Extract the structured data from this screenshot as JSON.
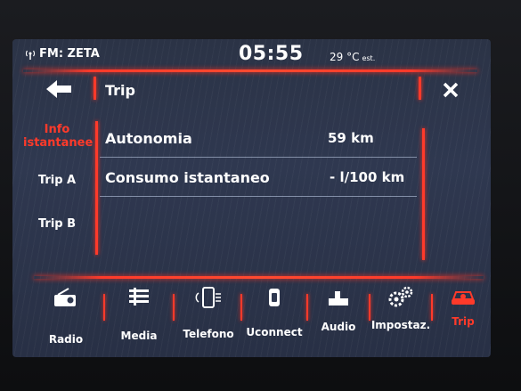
{
  "status": {
    "radio": "FM: ZETA",
    "clock": "05:55",
    "temperature": "29 °C",
    "temperature_note": "est."
  },
  "header": {
    "title": "Trip",
    "back_icon": "back-arrow-icon",
    "close_icon": "close-icon"
  },
  "side_tabs": [
    {
      "label_line1": "Info",
      "label_line2": "istantanee",
      "active": true
    },
    {
      "label_line1": "Trip A",
      "label_line2": "",
      "active": false
    },
    {
      "label_line1": "Trip B",
      "label_line2": "",
      "active": false
    }
  ],
  "rows": [
    {
      "label": "Autonomia",
      "value": "59 km"
    },
    {
      "label": "Consumo istantaneo",
      "value": "- l/100 km"
    }
  ],
  "nav": [
    {
      "label": "Radio",
      "icon": "radio-icon"
    },
    {
      "label": "Media",
      "icon": "media-icon"
    },
    {
      "label": "Telefono",
      "icon": "phone-icon"
    },
    {
      "label": "Uconnect",
      "icon": "uconnect-icon"
    },
    {
      "label": "Audio",
      "icon": "audio-icon"
    },
    {
      "label": "Impostaz.",
      "icon": "settings-icon"
    },
    {
      "label": "Trip",
      "icon": "trip-car-icon",
      "active": true
    }
  ],
  "colors": {
    "accent": "#ff3a2a",
    "background": "#2f3850",
    "text": "#ffffff"
  }
}
